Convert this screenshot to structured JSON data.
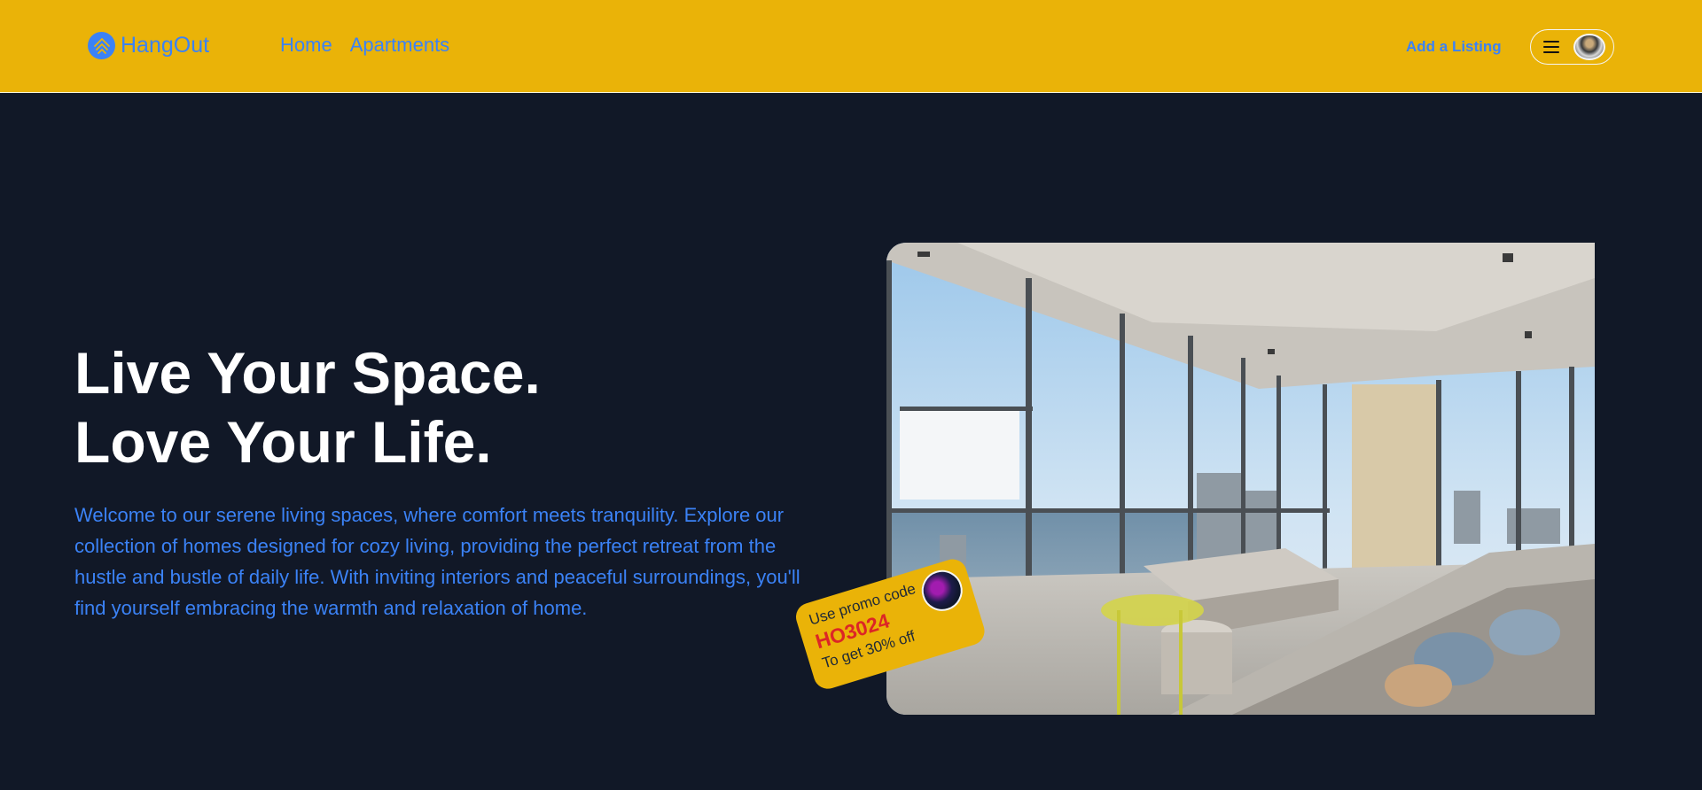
{
  "header": {
    "brand": "HangOut",
    "nav": [
      "Home",
      "Apartments"
    ],
    "add_listing": "Add a Listing"
  },
  "hero": {
    "title_line1": "Live Your Space.",
    "title_line2": "Love Your Life.",
    "description": "Welcome to our serene living spaces, where comfort meets tranquility. Explore our collection of homes designed for cozy living, providing the perfect retreat from the hustle and bustle of daily life. With inviting interiors and peaceful surroundings, you'll find yourself embracing the warmth and relaxation of home."
  },
  "promo": {
    "line1": "Use promo code",
    "code": "HO3024",
    "line2": "To get 30% off"
  },
  "colors": {
    "navbar": "#eab308",
    "page_background": "#111827",
    "accent": "#3b82f6",
    "promo_code": "#dc2626"
  },
  "icons": [
    "hangout-logo-icon",
    "menu-icon",
    "user-avatar"
  ]
}
